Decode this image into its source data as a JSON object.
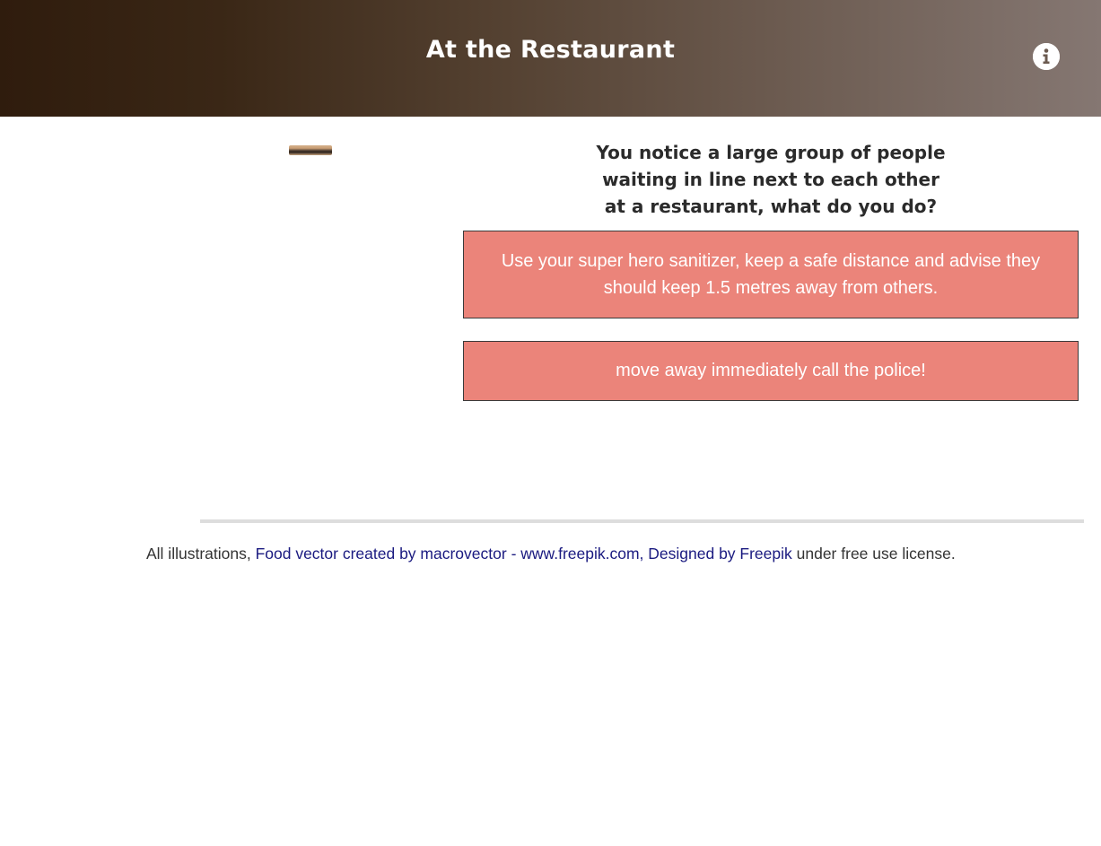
{
  "header": {
    "title": "At the Restaurant",
    "info_icon": "info-icon"
  },
  "scene": {
    "question_lines": [
      "You notice a large group of people",
      "waiting in line next to each other",
      "at a restaurant, what do you do?"
    ],
    "answers": [
      {
        "lines": [
          "Use your super hero sanitizer, keep a safe distance and advise they",
          "should keep 1.5 metres away from others."
        ]
      },
      {
        "lines": [
          "move away immediately call the police!"
        ]
      }
    ]
  },
  "footer": {
    "prefix": "All illustrations, ",
    "link_food_vector": "Food vector created by macrovector",
    "separator_dash": " - ",
    "link_freepik_site": "www.freepik.com",
    "comma": ", ",
    "link_designed_by": "Designed by Freepik",
    "suffix": " under free use license."
  },
  "colors": {
    "answer_background": "#eb847a",
    "header_gradient_start": "#2f1c0d",
    "header_gradient_end": "#857772",
    "link": "#1a1a80"
  }
}
